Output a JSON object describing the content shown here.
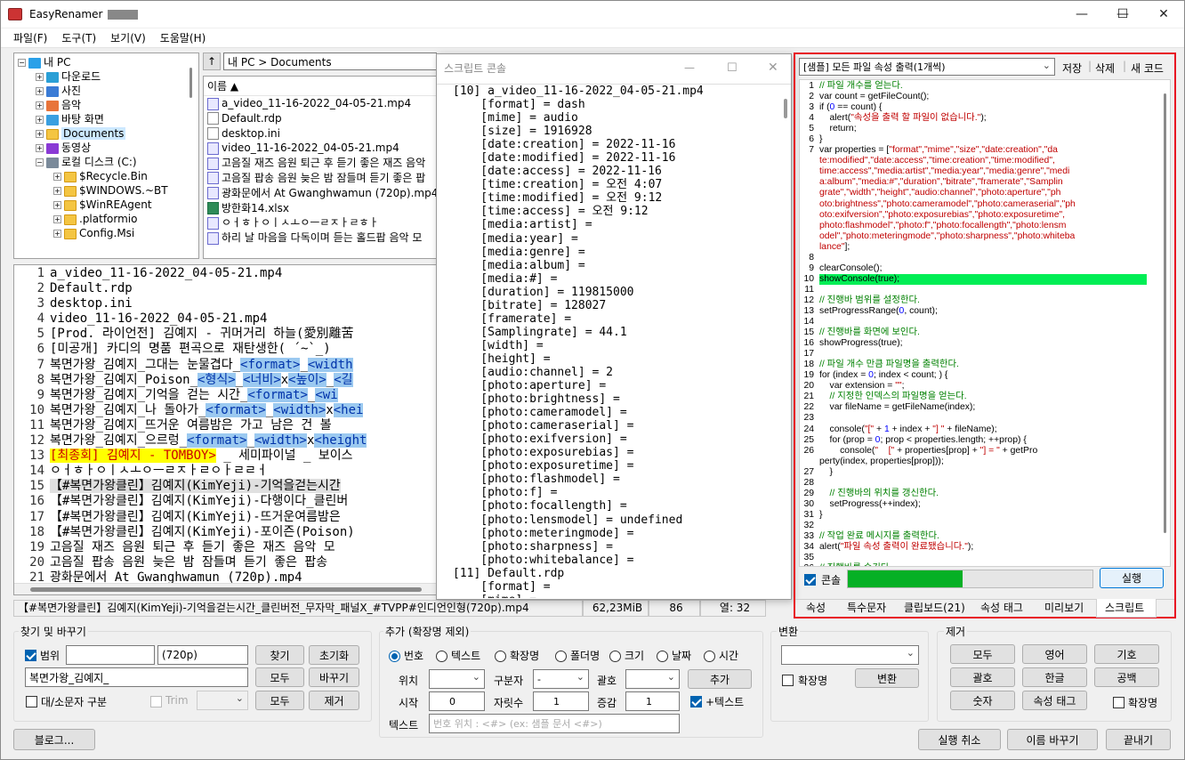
{
  "window": {
    "title": "EasyRenamer",
    "minimize": "—",
    "maximize": "☐",
    "close": "✕"
  },
  "menu": [
    "파일(F)",
    "도구(T)",
    "보기(V)",
    "도움말(H)"
  ],
  "tree": [
    {
      "label": "내 PC",
      "level": 0,
      "icon": "pc"
    },
    {
      "label": "다운로드",
      "level": 1,
      "icon": "download"
    },
    {
      "label": "사진",
      "level": 1,
      "icon": "photo"
    },
    {
      "label": "음악",
      "level": 1,
      "icon": "music"
    },
    {
      "label": "바탕 화면",
      "level": 1,
      "icon": "desktop"
    },
    {
      "label": "Documents",
      "level": 1,
      "icon": "folder",
      "selected": true
    },
    {
      "label": "동영상",
      "level": 1,
      "icon": "video"
    },
    {
      "label": "로컬 디스크 (C:)",
      "level": 1,
      "icon": "disk"
    },
    {
      "label": "$Recycle.Bin",
      "level": 2,
      "icon": "folder"
    },
    {
      "label": "$WINDOWS.~BT",
      "level": 2,
      "icon": "folder"
    },
    {
      "label": "$WinREAgent",
      "level": 2,
      "icon": "folder"
    },
    {
      "label": ".platformio",
      "level": 2,
      "icon": "folder"
    },
    {
      "label": "Config.Msi",
      "level": 2,
      "icon": "folder"
    }
  ],
  "path": {
    "up_icon": "↑",
    "value": "내 PC > Documents"
  },
  "filelist": {
    "header": "이름 ▲",
    "items": [
      {
        "name": "a_video_11-16-2022_04-05-21.mp4",
        "type": "mp4"
      },
      {
        "name": "Default.rdp",
        "type": "doc"
      },
      {
        "name": "desktop.ini",
        "type": "doc"
      },
      {
        "name": "video_11-16-2022_04-05-21.mp4",
        "type": "mp4"
      },
      {
        "name": "고음질 재즈 음원 퇴근 후 듣기 좋은 재즈 음악",
        "type": "mp4"
      },
      {
        "name": "고음질 팝송 음원 늦은 밤 잠들며 듣기 좋은 팝",
        "type": "mp4"
      },
      {
        "name": "광화문에서 At Gwanghwamun (720p).mp4",
        "type": "mp4"
      },
      {
        "name": "방한화14.xlsx",
        "type": "xls"
      },
      {
        "name": "ㅇㅓㅎㅏㅇㅣㅅㅗㅇㅡㄹㅈㅏㄹㅎㅏ",
        "type": "mp4"
      },
      {
        "name": "하리 날 마음을 다독이며 듣는 홀드팝 음악 모",
        "type": "mp4"
      }
    ]
  },
  "editor": {
    "lines": [
      [
        {
          "t": "a_video_11-16-2022_04-05-21.mp4"
        }
      ],
      [
        {
          "t": "Default.rdp"
        }
      ],
      [
        {
          "t": "desktop.ini"
        }
      ],
      [
        {
          "t": "video_11-16-2022_04-05-21.mp4"
        }
      ],
      [
        {
          "t": "[Prod. 라이언전] 김예지 - 귀머거리 하늘(愛別離苦"
        }
      ],
      [
        {
          "t": "[미공개] 카디의 명품 편곡으로 재탄생한( ´~`_)"
        }
      ],
      [
        {
          "t": "복면가왕_김예지_그대는 눈물겹다_"
        },
        {
          "t": "<format>",
          "c": "tg"
        },
        {
          "t": "_"
        },
        {
          "t": "<width",
          "c": "tg"
        }
      ],
      [
        {
          "t": "복면가왕_김예지_Poison_"
        },
        {
          "t": "<형식>",
          "c": "tg"
        },
        {
          "t": "_"
        },
        {
          "t": "<너비>",
          "c": "tg"
        },
        {
          "t": "x"
        },
        {
          "t": "<높이>",
          "c": "tg"
        },
        {
          "t": "_"
        },
        {
          "t": "<길",
          "c": "tg"
        }
      ],
      [
        {
          "t": "복면가왕_김예지_기억을 걷는 시간_"
        },
        {
          "t": "<format>",
          "c": "tg"
        },
        {
          "t": "_"
        },
        {
          "t": "<wi",
          "c": "tg"
        }
      ],
      [
        {
          "t": "복면가왕_김예지_나 돌아가_"
        },
        {
          "t": "<format>",
          "c": "tg"
        },
        {
          "t": "_"
        },
        {
          "t": "<width>",
          "c": "tg"
        },
        {
          "t": "x"
        },
        {
          "t": "<hei",
          "c": "tg"
        }
      ],
      [
        {
          "t": "복면가왕_김예지_뜨거운 여름밤은 가고 남은 건 볼"
        }
      ],
      [
        {
          "t": "복면가왕_김예지_으르렁_"
        },
        {
          "t": "<format>",
          "c": "tg"
        },
        {
          "t": "_"
        },
        {
          "t": "<width>",
          "c": "tg"
        },
        {
          "t": "x"
        },
        {
          "t": "<height",
          "c": "tg"
        }
      ],
      [
        {
          "t": "[최종회] 김예지 - TOMBOY>",
          "c": "hl-y"
        },
        {
          "t": " _ 세미파이널 _ 보이스"
        }
      ],
      [
        {
          "t": "ㅇㅓㅎㅏㅇㅣㅅㅗㅇㅡㄹㅈㅏㄹㅇㅏㄹㄹㅓ"
        }
      ],
      [
        {
          "t": "【#복면가왕클린】김예지(KimYeji)-기억을걷는시간",
          "c": "hl-g"
        }
      ],
      [
        {
          "t": "【#복면가왕클린】김예지(KimYeji)-다행이다_클린버"
        }
      ],
      [
        {
          "t": "【#복면가왕클린】김예지(KimYeji)-뜨거운여름밤은"
        }
      ],
      [
        {
          "t": "【#복면가왕클린】김예지(KimYeji)-포이즌(Poison)"
        }
      ],
      [
        {
          "t": "고음질 재즈 음원 퇴근 후 듣기 좋은 재즈 음악 모"
        }
      ],
      [
        {
          "t": "고음질 팝송 음원 늦은 밤 잠들며 듣기 좋은 팝송"
        }
      ],
      [
        {
          "t": "광화문에서 At Gwanghwamun (720p).mp4"
        }
      ]
    ]
  },
  "console": {
    "title": "스크립트 콘솔",
    "lines": [
      "[10] a_video_11-16-2022_04-05-21.mp4",
      "    [format] = dash",
      "    [mime] = audio",
      "    [size] = 1916928",
      "    [date:creation] = 2022-11-16",
      "    [date:modified] = 2022-11-16",
      "    [date:access] = 2022-11-16",
      "    [time:creation] = 오전 4:07",
      "    [time:modified] = 오전 9:12",
      "    [time:access] = 오전 9:12",
      "    [media:artist] =",
      "    [media:year] =",
      "    [media:genre] =",
      "    [media:album] =",
      "    [media:#] =",
      "    [duration] = 119815000",
      "    [bitrate] = 128027",
      "    [framerate] =",
      "    [Samplingrate] = 44.1",
      "    [width] =",
      "    [height] =",
      "    [audio:channel] = 2",
      "    [photo:aperture] =",
      "    [photo:brightness] =",
      "    [photo:cameramodel] =",
      "    [photo:cameraserial] =",
      "    [photo:exifversion] =",
      "    [photo:exposurebias] =",
      "    [photo:exposuretime] =",
      "    [photo:flashmodel] =",
      "    [photo:f] =",
      "    [photo:focallength] =",
      "    [photo:lensmodel] = undefined",
      "    [photo:meteringmode] =",
      "    [photo:sharpness] =",
      "    [photo:whitebalance] =",
      "[11] Default.rdp",
      "    [format] =",
      "    [mime] ="
    ]
  },
  "script": {
    "selected": "[샘플] 모든 파일 속성 출력(1개씩)",
    "save": "저장",
    "delete": "삭제",
    "new": "새 코드",
    "code": [
      {
        "n": "1",
        "p": [
          {
            "t": "// 파일 개수를 얻는다.",
            "c": "cm"
          }
        ]
      },
      {
        "n": "2",
        "p": [
          {
            "t": "var count = getFileCount();"
          }
        ]
      },
      {
        "n": "3",
        "p": [
          {
            "t": "if ("
          },
          {
            "t": "0",
            "c": "num"
          },
          {
            "t": " == count) {"
          }
        ]
      },
      {
        "n": "4",
        "p": [
          {
            "t": "    alert("
          },
          {
            "t": "\"속성을 출력 할 파일이 없습니다.\"",
            "c": "st"
          },
          {
            "t": ");"
          }
        ]
      },
      {
        "n": "5",
        "p": [
          {
            "t": "    return;"
          }
        ]
      },
      {
        "n": "6",
        "p": [
          {
            "t": "}"
          }
        ]
      },
      {
        "n": "7",
        "p": [
          {
            "t": "var properties = ["
          },
          {
            "t": "\"format\",\"mime\",\"size\",\"date:creation\",\"da",
            "c": "st"
          }
        ]
      },
      {
        "n": "",
        "p": [
          {
            "t": "te:modified\",\"date:access\",\"time:creation\",\"time:modified\",",
            "c": "st"
          }
        ]
      },
      {
        "n": "",
        "p": [
          {
            "t": "time:access\",\"media:artist\",\"media:year\",\"media:genre\",\"medi",
            "c": "st"
          }
        ]
      },
      {
        "n": "",
        "p": [
          {
            "t": "a:album\",\"media:#\",\"duration\",\"bitrate\",\"framerate\",\"Samplin",
            "c": "st"
          }
        ]
      },
      {
        "n": "",
        "p": [
          {
            "t": "grate\",\"width\",\"height\",\"audio:channel\",\"photo:aperture\",\"ph",
            "c": "st"
          }
        ]
      },
      {
        "n": "",
        "p": [
          {
            "t": "oto:brightness\",\"photo:cameramodel\",\"photo:cameraserial\",\"ph",
            "c": "st"
          }
        ]
      },
      {
        "n": "",
        "p": [
          {
            "t": "oto:exifversion\",\"photo:exposurebias\",\"photo:exposuretime\",",
            "c": "st"
          }
        ]
      },
      {
        "n": "",
        "p": [
          {
            "t": "photo:flashmodel\",\"photo:f\",\"photo:focallength\",\"photo:lensm",
            "c": "st"
          }
        ]
      },
      {
        "n": "",
        "p": [
          {
            "t": "odel\",\"photo:meteringmode\",\"photo:sharpness\",\"photo:whiteba",
            "c": "st"
          }
        ]
      },
      {
        "n": "",
        "p": [
          {
            "t": "lance\"",
            "c": "st"
          },
          {
            "t": "];"
          }
        ]
      },
      {
        "n": "8",
        "p": []
      },
      {
        "n": "9",
        "p": [
          {
            "t": "clearConsole();"
          }
        ]
      },
      {
        "n": "10",
        "p": [
          {
            "t": "showConsole(true);"
          }
        ],
        "hl": true
      },
      {
        "n": "11",
        "p": []
      },
      {
        "n": "12",
        "p": [
          {
            "t": "// 진행바 범위를 설정한다.",
            "c": "cm"
          }
        ]
      },
      {
        "n": "13",
        "p": [
          {
            "t": "setProgressRange("
          },
          {
            "t": "0",
            "c": "num"
          },
          {
            "t": ", count);"
          }
        ]
      },
      {
        "n": "14",
        "p": []
      },
      {
        "n": "15",
        "p": [
          {
            "t": "// 진행바를 화면에 보인다.",
            "c": "cm"
          }
        ]
      },
      {
        "n": "16",
        "p": [
          {
            "t": "showProgress(true);"
          }
        ]
      },
      {
        "n": "17",
        "p": []
      },
      {
        "n": "18",
        "p": [
          {
            "t": "// 파일 개수 만큼 파일명을 출력한다.",
            "c": "cm"
          }
        ]
      },
      {
        "n": "19",
        "p": [
          {
            "t": "for (index = "
          },
          {
            "t": "0",
            "c": "num"
          },
          {
            "t": "; index < count; ) {"
          }
        ]
      },
      {
        "n": "20",
        "p": [
          {
            "t": "    var extension = "
          },
          {
            "t": "\"\"",
            "c": "st"
          },
          {
            "t": ";"
          }
        ]
      },
      {
        "n": "21",
        "p": [
          {
            "t": "    // 지정한 인덱스의 파일명을 얻는다.",
            "c": "cm"
          }
        ]
      },
      {
        "n": "22",
        "p": [
          {
            "t": "    var fileName = getFileName(index);"
          }
        ]
      },
      {
        "n": "23",
        "p": []
      },
      {
        "n": "24",
        "p": [
          {
            "t": "    console("
          },
          {
            "t": "\"[\"",
            "c": "st"
          },
          {
            "t": " + "
          },
          {
            "t": "1",
            "c": "num"
          },
          {
            "t": " + index + "
          },
          {
            "t": "\"] \"",
            "c": "st"
          },
          {
            "t": " + fileName);"
          }
        ]
      },
      {
        "n": "25",
        "p": [
          {
            "t": "    for (prop = "
          },
          {
            "t": "0",
            "c": "num"
          },
          {
            "t": "; prop < properties.length; ++prop) {"
          }
        ]
      },
      {
        "n": "26",
        "p": [
          {
            "t": "        console("
          },
          {
            "t": "\"    [\"",
            "c": "st"
          },
          {
            "t": " + properties[prop] + "
          },
          {
            "t": "\"] = \"",
            "c": "st"
          },
          {
            "t": " + getPro"
          }
        ]
      },
      {
        "n": "",
        "p": [
          {
            "t": "perty(index, properties[prop]));"
          }
        ]
      },
      {
        "n": "27",
        "p": [
          {
            "t": "    }"
          }
        ]
      },
      {
        "n": "28",
        "p": []
      },
      {
        "n": "29",
        "p": [
          {
            "t": "    // 진행바의 위치를 갱신한다.",
            "c": "cm"
          }
        ]
      },
      {
        "n": "30",
        "p": [
          {
            "t": "    setProgress(++index);"
          }
        ]
      },
      {
        "n": "31",
        "p": [
          {
            "t": "}"
          }
        ]
      },
      {
        "n": "32",
        "p": []
      },
      {
        "n": "33",
        "p": [
          {
            "t": "// 작업 완료 메시지를 출력한다.",
            "c": "cm"
          }
        ]
      },
      {
        "n": "34",
        "p": [
          {
            "t": "alert("
          },
          {
            "t": "\"파일 속성 출력이 완료됐습니다.\"",
            "c": "st"
          },
          {
            "t": ");"
          }
        ]
      },
      {
        "n": "35",
        "p": []
      },
      {
        "n": "36",
        "p": [
          {
            "t": "// 진행바를 숨긴다.",
            "c": "cm"
          }
        ]
      }
    ],
    "console_label": "콘솔",
    "progress": 0.47,
    "run": "실행"
  },
  "righttabs": [
    "속성",
    "특수문자",
    "클립보드(21)",
    "속성 태그",
    "미리보기",
    "스크립트"
  ],
  "status": {
    "file": "【#복면가왕클린】김예지(KimYeji)-기억을걷는시간_클린버전_무자막_패널X_#TVPP#인디언인형(720p).mp4",
    "size": "62,23MiB",
    "count": "86",
    "col": "열: 32"
  },
  "find": {
    "title": "찾기 및 바꾸기",
    "range_label": "범위",
    "range_value": "",
    "range_value2": "(720p)",
    "find_btn": "찾기",
    "reset_btn": "초기화",
    "replace_value": "복면가왕_김예지_",
    "all_btn": "모두",
    "replace_btn": "바꾸기",
    "case_label": "대/소문자 구분",
    "trim_label": "Trim",
    "all_btn2": "모두",
    "remove_btn": "제거"
  },
  "blog_btn": "블로그...",
  "add": {
    "title": "추가 (확장명 제외)",
    "radios": [
      "번호",
      "텍스트",
      "확장명",
      "폴더명",
      "크기",
      "날짜",
      "시간"
    ],
    "pos_label": "위치",
    "sep_label": "구분자",
    "sep_value": "-",
    "bracket_label": "괄호",
    "add_btn": "추가",
    "start_label": "시작",
    "start_value": "0",
    "digits_label": "자릿수",
    "digits_value": "1",
    "inc_label": "증감",
    "inc_value": "1",
    "plustext_label": "+텍스트",
    "text_label": "텍스트",
    "text_placeholder": "번호 위치 : <#> (ex: 샘플 문서 <#>)"
  },
  "convert": {
    "title": "변환",
    "ext_label": "확장명",
    "convert_btn": "변환"
  },
  "remove": {
    "title": "제거",
    "btns": [
      "모두",
      "영어",
      "기호",
      "괄호",
      "한글",
      "공백",
      "숫자",
      "속성 태그"
    ],
    "ext_label": "확장명"
  },
  "bottom": {
    "cancel": "실행 취소",
    "rename": "이름 바꾸기",
    "exit": "끝내기"
  }
}
